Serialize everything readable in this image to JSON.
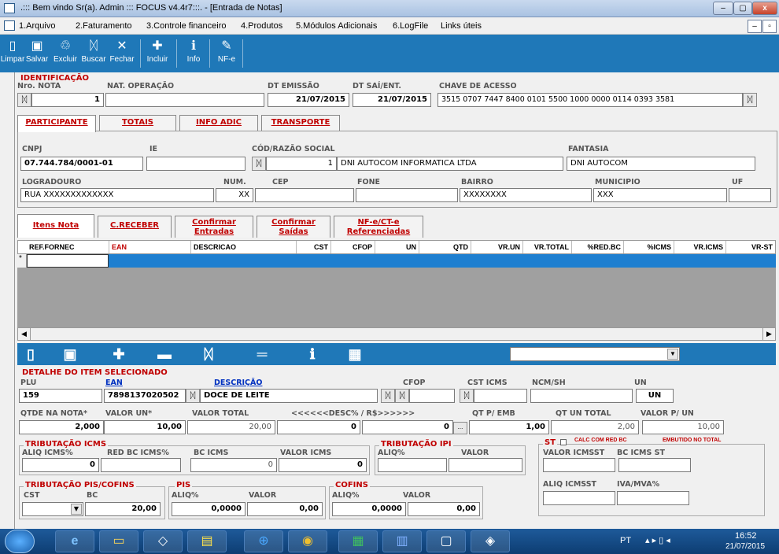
{
  "window": {
    "title": ".::: Bem vindo Sr(a). Admin ::: FOCUS v4.4r7:::.  - [Entrada de Notas]",
    "min": "–",
    "max": "▢",
    "close": "x",
    "child_min": "–",
    "child_restore": "▫"
  },
  "menu": [
    "1.Arquivo",
    "2.Faturamento",
    "3.Controle financeiro",
    "4.Produtos",
    "5.Módulos Adicionais",
    "6.LogFile",
    "Links úteis"
  ],
  "toolbar": {
    "limpar": "Limpar",
    "salvar": "Salvar",
    "excluir": "Excluir",
    "buscar": "Buscar",
    "fechar": "Fechar",
    "incluir": "Incluir",
    "info": "Info",
    "nfe": "NF-e"
  },
  "ident": {
    "section": "IDENTIFICAÇÃO",
    "nro_label": "Nro. NOTA",
    "nro": "1",
    "natop_label": "NAT. OPERAÇÃO",
    "natop": "",
    "dtemissao_label": "DT EMISSÃO",
    "dtemissao": "21/07/2015",
    "dtsai_label": "DT SAÍ/ENT.",
    "dtsai": "21/07/2015",
    "chave_label": "CHAVE DE ACESSO",
    "chave": "3515 0707 7447 8400 0101 5500 1000 0000 0114 0393 3581"
  },
  "tabs1": [
    "PARTICIPANTE",
    "TOTAIS",
    "INFO ADIC",
    "TRANSPORTE"
  ],
  "part": {
    "cnpj_label": "CNPJ",
    "cnpj": "07.744.784/0001-01",
    "ie_label": "IE",
    "ie": "",
    "cod_label": "CÓD/RAZÃO SOCIAL",
    "cod": "1",
    "razao": "DNI AUTOCOM INFORMATICA LTDA",
    "fant_label": "FANTASIA",
    "fant": "DNI AUTOCOM",
    "logr_label": "LOGRADOURO",
    "logr": "RUA XXXXXXXXXXXXX",
    "num_label": "NUM.",
    "num": "XX",
    "cep_label": "CEP",
    "cep": "",
    "fone_label": "FONE",
    "fone": "",
    "bairro_label": "BAIRRO",
    "bairro": "XXXXXXXX",
    "mun_label": "MUNICIPIO",
    "mun": "XXX",
    "uf_label": "UF",
    "uf": ""
  },
  "tabs2": [
    {
      "l1": "Itens Nota",
      "l2": ""
    },
    {
      "l1": "C.RECEBER",
      "l2": ""
    },
    {
      "l1": "Confirmar",
      "l2": "Entradas"
    },
    {
      "l1": "Confirmar",
      "l2": "Saídas"
    },
    {
      "l1": "NF-e/CT-e",
      "l2": "Referenciadas"
    }
  ],
  "grid": {
    "headers": [
      "REF.FORNEC",
      "EAN",
      "DESCRICAO",
      "CST",
      "CFOP",
      "UN",
      "QTD",
      "VR.UN",
      "VR.TOTAL",
      "%RED.BC",
      "%ICMS",
      "VR.ICMS",
      "VR-ST"
    ],
    "newrow": "*"
  },
  "item": {
    "section": "DETALHE DO ITEM SELECIONADO",
    "plu_label": "PLU",
    "plu": "159",
    "ean_label": "EAN",
    "ean": "7898137020502",
    "desc_label": "DESCRIÇÃO",
    "desc": "DOCE DE LEITE",
    "cfop_label": "CFOP",
    "cfop": "",
    "csticms_label": "CST ICMS",
    "csticms": "",
    "ncm_label": "NCM/SH",
    "ncm": "",
    "un_label": "UN",
    "un": "UN",
    "qtde_label": "QTDE NA NOTA*",
    "qtde": "2,000",
    "vun_label": "VALOR UN*",
    "vun": "10,00",
    "vtot_label": "VALOR TOTAL",
    "vtot": "20,00",
    "desc2_label": "<<<<<<DESC% / R$>>>>>>",
    "descp": "0",
    "descv": "0",
    "dots": "...",
    "qtemb_label": "QT P/ EMB",
    "qtemb": "1,00",
    "qtuntot_label": "QT UN TOTAL",
    "qtuntot": "2,00",
    "vpun_label": "VALOR P/ UN",
    "vpun": "10,00"
  },
  "icms": {
    "title": "TRIBUTAÇÃO ICMS",
    "aliq_label": "ALIQ ICMS%",
    "aliq": "0",
    "redbc_label": "RED BC ICMS%",
    "redbc": "",
    "bc_label": "BC ICMS",
    "bc": "0",
    "vicms_label": "VALOR ICMS",
    "vicms": "0"
  },
  "ipi": {
    "title": "TRIBUTAÇÃO IPI",
    "aliq_label": "ALIQ%",
    "valor_label": "VALOR"
  },
  "st": {
    "title": "ST",
    "calc": "CALC COM RED BC",
    "embut": "EMBUTIDO NO TOTAL",
    "vicmsst_label": "VALOR ICMSST",
    "bcst_label": "BC ICMS ST",
    "aliqst_label": "ALIQ ICMSST",
    "iva_label": "IVA/MVA%"
  },
  "pis": {
    "title": "TRIBUTAÇÃO PIS/COFINS",
    "cst_label": "CST",
    "bc_label": "BC",
    "bc": "20,00",
    "pis_title": "PIS",
    "aliq_label": "ALIQ%",
    "aliq": "0,0000",
    "valor_label": "VALOR",
    "valor": "0,00",
    "cof_title": "COFINS",
    "caliq_label": "ALIQ%",
    "caliq": "0,0000",
    "cvalor_label": "VALOR",
    "cvalor": "0,00"
  },
  "taskbar": {
    "lang": "PT",
    "time": "16:52",
    "date": "21/07/2015"
  }
}
